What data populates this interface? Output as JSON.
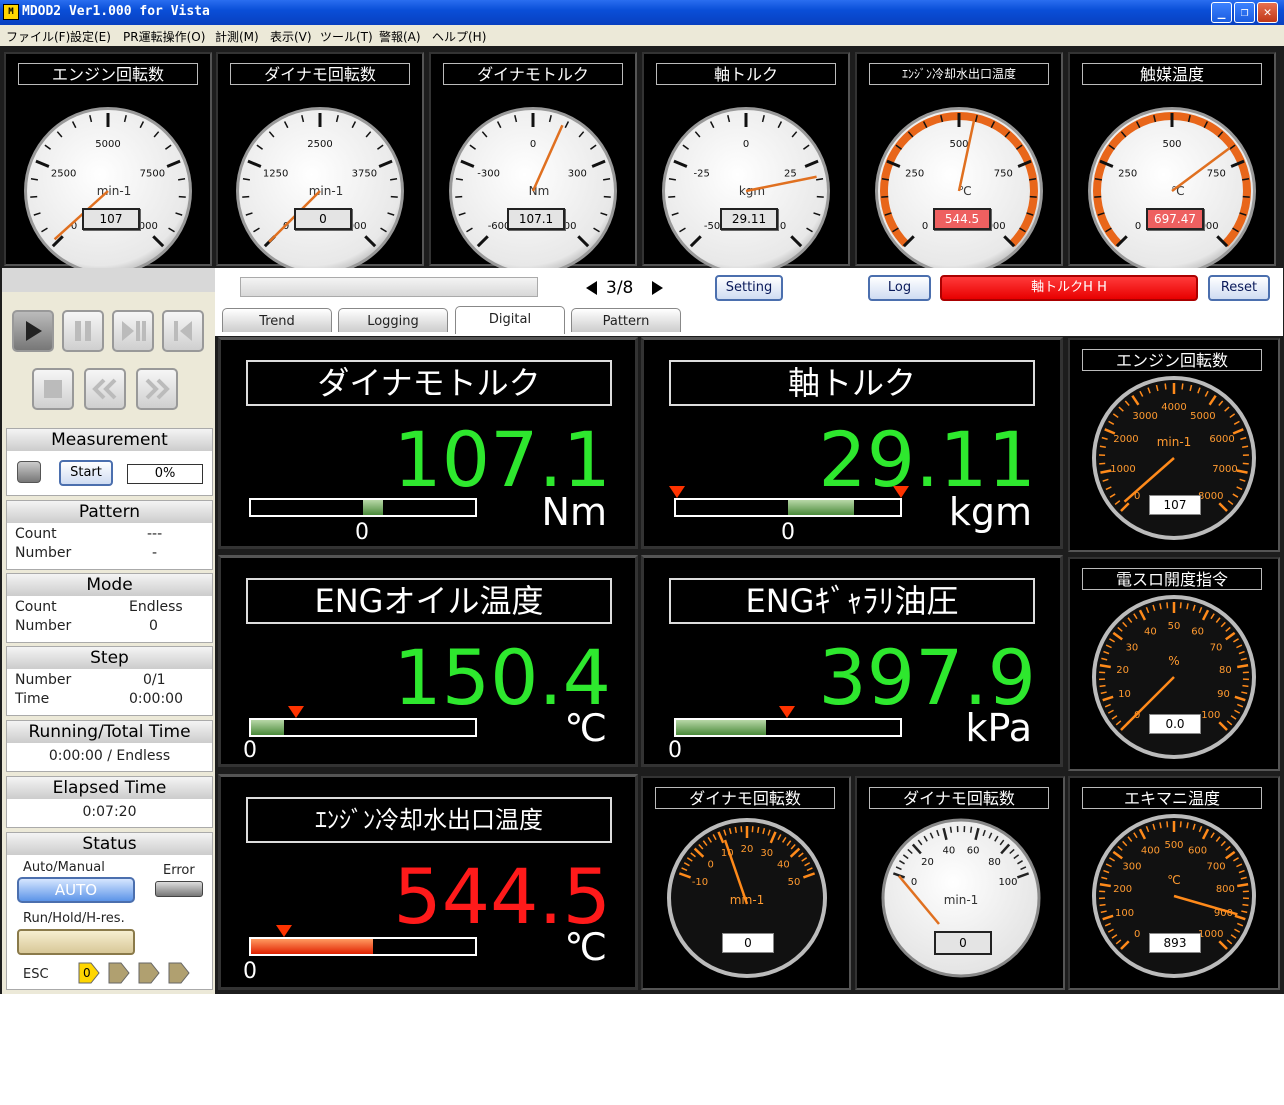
{
  "window": {
    "title": "MDOD2 Ver1.000 for Vista"
  },
  "menu": [
    "ファイル(F)",
    "設定(E)",
    "PR運転操作(O)",
    "計測(M)",
    "表示(V)",
    "ツール(T)",
    "警報(A)",
    "ヘルプ(H)"
  ],
  "gauges": [
    {
      "title": "エンジン回転数",
      "unit": "min-1",
      "labels": [
        "0",
        "2500",
        "5000",
        "7500",
        "10000"
      ],
      "value": "107",
      "min": 0,
      "max": 10000,
      "v": 107,
      "needle": "#e07020",
      "hi": false,
      "alarm": false,
      "small": false
    },
    {
      "title": "ダイナモ回転数",
      "unit": "min-1",
      "labels": [
        "0",
        "1250",
        "2500",
        "3750",
        "5000"
      ],
      "value": "0",
      "min": 0,
      "max": 5000,
      "v": 0,
      "needle": "#e07020",
      "hi": false,
      "alarm": false,
      "small": false
    },
    {
      "title": "ダイナモトルク",
      "unit": "Nm",
      "labels": [
        "-600",
        "-300",
        "0",
        "300",
        "600"
      ],
      "value": "107.1",
      "min": -600,
      "max": 600,
      "v": 107.1,
      "needle": "#e07020",
      "hi": false,
      "alarm": false,
      "small": false
    },
    {
      "title": "軸トルク",
      "unit": "kgm",
      "labels": [
        "-50",
        "-25",
        "0",
        "25",
        "50"
      ],
      "value": "29.11",
      "min": -50,
      "max": 50,
      "v": 29.11,
      "needle": "#e07020",
      "hi": false,
      "alarm": false,
      "small": false
    },
    {
      "title": "ｴﾝｼﾞﾝ冷却水出口温度",
      "unit": "℃",
      "labels": [
        "0",
        "250",
        "500",
        "750",
        "1000"
      ],
      "value": "544.5",
      "min": 0,
      "max": 1000,
      "v": 544.5,
      "needle": "#e07020",
      "hi": true,
      "alarm": true,
      "small": true
    },
    {
      "title": "触媒温度",
      "unit": "℃",
      "labels": [
        "0",
        "250",
        "500",
        "750",
        "1000"
      ],
      "value": "697.47",
      "min": 0,
      "max": 1000,
      "v": 697.47,
      "needle": "#e07020",
      "hi": true,
      "alarm": true,
      "small": false
    }
  ],
  "toolbar": {
    "page": "3/8",
    "setting": "Setting",
    "log": "Log",
    "alarm": "軸トルクH H",
    "reset": "Reset"
  },
  "tabs": [
    "Trend",
    "Logging",
    "Digital",
    "Pattern"
  ],
  "left": {
    "measurement": {
      "title": "Measurement",
      "start": "Start",
      "progress": "0%"
    },
    "pattern": {
      "title": "Pattern",
      "count_label": "Count",
      "count": "---",
      "number_label": "Number",
      "number": "-"
    },
    "mode": {
      "title": "Mode",
      "count_label": "Count",
      "count": "Endless",
      "number_label": "Number",
      "number": "0"
    },
    "step": {
      "title": "Step",
      "number_label": "Number",
      "number": "0/1",
      "time_label": "Time",
      "time": "0:00:00"
    },
    "running": {
      "title": "Running/Total Time",
      "value": "0:00:00 / Endless"
    },
    "elapsed": {
      "title": "Elapsed Time",
      "value": "0:07:20"
    },
    "status": {
      "title": "Status",
      "auto_manual_label": "Auto/Manual",
      "auto": "AUTO",
      "error_label": "Error",
      "run_label": "Run/Hold/H-res.",
      "esc": "ESC",
      "esc_num": "0"
    }
  },
  "digital": [
    {
      "title": "ダイナモトルク",
      "value": "107.1",
      "unit": "Nm",
      "zero": "0",
      "alarm": false
    },
    {
      "title": "軸トルク",
      "value": "29.11",
      "unit": "kgm",
      "zero": "0",
      "alarm": false
    },
    {
      "title": "ENGオイル温度",
      "value": "150.4",
      "unit": "℃",
      "zero": "0",
      "alarm": false
    },
    {
      "title": "ENGｷﾞｬﾗﾘ油圧",
      "value": "397.9",
      "unit": "kPa",
      "zero": "0",
      "alarm": false
    },
    {
      "title": "ｴﾝｼﾞﾝ冷却水出口温度",
      "value": "544.5",
      "unit": "℃",
      "zero": "0",
      "alarm": true
    }
  ],
  "rgauges": [
    {
      "title": "エンジン回転数",
      "unit": "min-1",
      "labels": [
        "0",
        "1000",
        "2000",
        "3000",
        "4000",
        "5000",
        "6000",
        "7000",
        "8000"
      ],
      "value": "107",
      "min": 0,
      "max": 8000,
      "v": 107
    },
    {
      "title": "電スロ開度指令",
      "unit": "%",
      "labels": [
        "0",
        "10",
        "20",
        "30",
        "40",
        "50",
        "60",
        "70",
        "80",
        "90",
        "100"
      ],
      "value": "0.0",
      "min": 0,
      "max": 100,
      "v": 0
    },
    {
      "title": "エキマニ温度",
      "unit": "℃",
      "labels": [
        "0",
        "100",
        "200",
        "300",
        "400",
        "500",
        "600",
        "700",
        "800",
        "900",
        "1000"
      ],
      "value": "893",
      "min": 0,
      "max": 1000,
      "v": 893
    }
  ],
  "bgauges": [
    {
      "title": "ダイナモ回転数",
      "unit": "min-1",
      "labels": [
        "-10",
        "0",
        "10",
        "20",
        "30",
        "40",
        "50"
      ],
      "value": "0"
    },
    {
      "title": "ダイナモ回転数",
      "unit": "min-1",
      "labels": [
        "0",
        "20",
        "40",
        "60",
        "80",
        "100"
      ],
      "value": "0"
    }
  ]
}
